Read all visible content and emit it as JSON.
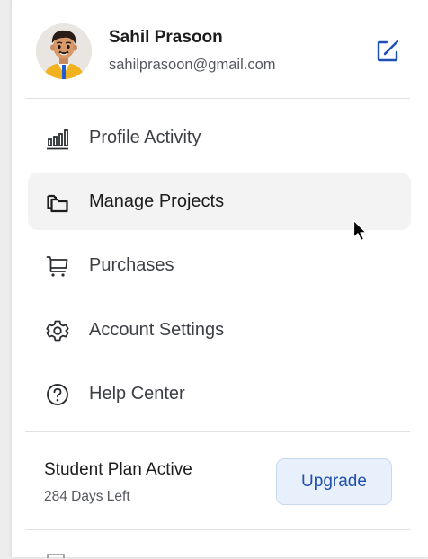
{
  "user": {
    "name": "Sahil Prasoon",
    "email": "sahilprasoon@gmail.com"
  },
  "menu": {
    "items": [
      {
        "label": "Profile Activity",
        "icon": "bar-chart-icon",
        "active": false
      },
      {
        "label": "Manage Projects",
        "icon": "folders-icon",
        "active": true
      },
      {
        "label": "Purchases",
        "icon": "cart-icon",
        "active": false
      },
      {
        "label": "Account Settings",
        "icon": "gear-icon",
        "active": false
      },
      {
        "label": "Help Center",
        "icon": "help-circle-icon",
        "active": false
      }
    ]
  },
  "plan": {
    "title": "Student Plan Active",
    "days_left": "284 Days Left",
    "upgrade_label": "Upgrade"
  },
  "colors": {
    "accent": "#1f4fb0",
    "accent_bg": "#e8f0fc",
    "active_bg": "#f3f3f3",
    "text_primary": "#1d1d1f",
    "text_secondary": "#55585e"
  }
}
